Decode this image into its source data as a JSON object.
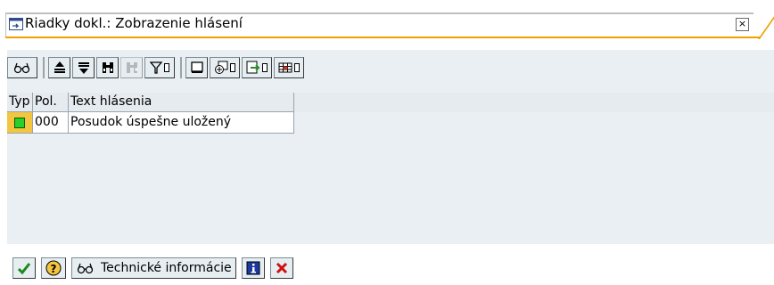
{
  "window": {
    "title": "Riadky dokl.: Zobrazenie hlásení",
    "close_icon": "close-icon"
  },
  "toolbar": {
    "buttons": [
      {
        "name": "details",
        "icon": "glasses-icon",
        "enabled": true
      },
      {
        "name": "sort-ascending",
        "icon": "sort-ascending-icon",
        "enabled": true
      },
      {
        "name": "sort-descending",
        "icon": "sort-descending-icon",
        "enabled": true
      },
      {
        "name": "find",
        "icon": "binoculars-icon",
        "enabled": true
      },
      {
        "name": "find-next",
        "icon": "binoculars-plus-icon",
        "enabled": false
      },
      {
        "name": "filter",
        "icon": "filter-icon",
        "enabled": true,
        "menu": true
      },
      {
        "name": "print-preview",
        "icon": "print-preview-icon",
        "enabled": true
      },
      {
        "name": "views",
        "icon": "views-icon",
        "enabled": true,
        "menu": true
      },
      {
        "name": "export",
        "icon": "export-icon",
        "enabled": true,
        "menu": true
      },
      {
        "name": "layout",
        "icon": "grid-layout-icon",
        "enabled": true,
        "menu": true
      }
    ]
  },
  "table": {
    "columns": [
      "Typ",
      "Pol.",
      "Text hlásenia"
    ],
    "rows": [
      {
        "status": "green-led-icon",
        "pos": "000",
        "text": "Posudok úspešne uložený"
      }
    ]
  },
  "footer": {
    "technical_info_label": "Technické informácie",
    "ok_icon": "checkmark-icon",
    "help_icon": "help-icon",
    "info_icon": "info-icon",
    "cancel_icon": "cancel-x-icon"
  },
  "colors": {
    "accent": "#f0a000",
    "status_cell": "#f4c640",
    "led_green": "#28d028",
    "panel_bg": "#e9eff3"
  }
}
